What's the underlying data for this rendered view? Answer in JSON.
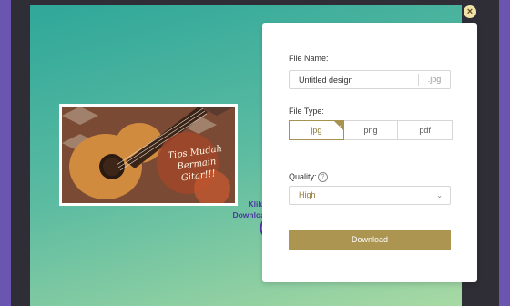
{
  "dialog": {
    "close_label": "×"
  },
  "preview": {
    "caption": "Tips Mudah Bermain Gitar!!!"
  },
  "hint": {
    "text_line1": "Klik untuk",
    "text_line2": "Download Gambar"
  },
  "panel": {
    "file_name_label": "File Name:",
    "file_name_value": "Untitled design",
    "file_name_extension": ".jpg",
    "file_type_label": "File Type:",
    "file_types": [
      {
        "label": "jpg",
        "selected": true
      },
      {
        "label": "png",
        "selected": false
      },
      {
        "label": "pdf",
        "selected": false
      }
    ],
    "quality_label": "Quality:",
    "quality_value": "High",
    "download_label": "Download"
  },
  "colors": {
    "accent": "#ab9551",
    "backdrop": "#6a55b0",
    "canvas_top": "#2fa79a",
    "canvas_bottom": "#a8d9a3",
    "hint_text": "#4b3aa0"
  },
  "icons": {
    "close": "close-icon",
    "check": "check-icon",
    "help": "help-circle-icon",
    "chevron": "chevron-down-icon",
    "arrow": "curved-arrow-icon"
  }
}
